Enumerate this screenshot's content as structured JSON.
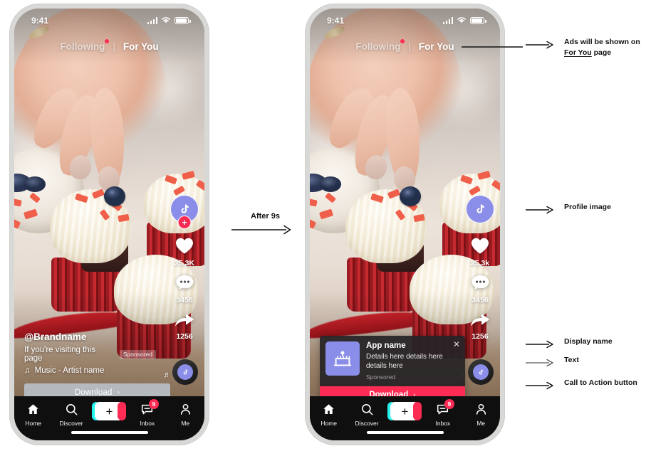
{
  "status_bar": {
    "time": "9:41",
    "signal_icon": "cellular-signal-icon",
    "wifi_icon": "wifi-icon",
    "battery_icon": "battery-icon"
  },
  "top_tabs": {
    "following": "Following",
    "divider": "|",
    "for_you": "For You"
  },
  "rail": {
    "profile_icon": "tiktok-note-icon",
    "follow_plus": "+",
    "like_icon": "heart-icon",
    "like_count_1": "25.3K",
    "like_count_2": "25.3k",
    "comment_icon": "comment-bubble-icon",
    "comment_count": "3456",
    "share_icon": "share-arrow-icon",
    "share_count": "1256",
    "music_disc_icon": "music-disc-icon",
    "music_notes_icon": "music-notes-icon"
  },
  "caption": {
    "handle": "@Brandname",
    "text": "If you're visiting this page",
    "sponsored": "Sponsored",
    "music_icon": "music-note-icon",
    "music": "Music - Artist name"
  },
  "download_bar": {
    "label": "Download",
    "chevron": "›"
  },
  "ad_card": {
    "app_icon": "cake-app-icon",
    "title": "App name",
    "description": "Details here details here details here",
    "sponsored": "Sponsored",
    "close_icon": "close-icon",
    "cta_label": "Download",
    "cta_chevron": "›"
  },
  "bottom_nav": {
    "items": [
      {
        "icon": "home-icon",
        "label": "Home"
      },
      {
        "icon": "search-icon",
        "label": "Discover"
      },
      {
        "icon": "create-plus-icon",
        "label": "",
        "plus": "+"
      },
      {
        "icon": "inbox-icon",
        "label": "Inbox",
        "badge": "9"
      },
      {
        "icon": "person-icon",
        "label": "Me"
      }
    ]
  },
  "transition": {
    "label": "After 9s",
    "arrow_icon": "right-arrow-icon"
  },
  "annotations": [
    {
      "arrow_icon": "right-arrow-icon",
      "line1_pre": "Ads will be shown on ",
      "line2_underlined": "For You",
      "line2_post": " page"
    },
    {
      "arrow_icon": "right-arrow-icon",
      "label": "Profile image"
    },
    {
      "arrow_icon": "right-arrow-icon",
      "label": "Display name"
    },
    {
      "arrow_icon": "right-arrow-icon",
      "label": "Text"
    },
    {
      "arrow_icon": "right-arrow-icon",
      "label": "Call to Action button"
    }
  ],
  "colors": {
    "tiktok_red": "#fe2c55",
    "tiktok_cyan": "#25f4ee",
    "app_icon_purple": "#8b8ee8",
    "nav_background": "#100f10",
    "phone_frame": "#d8d8d6",
    "download_bar_overlay": "rgba(190,204,214,0.80)"
  }
}
